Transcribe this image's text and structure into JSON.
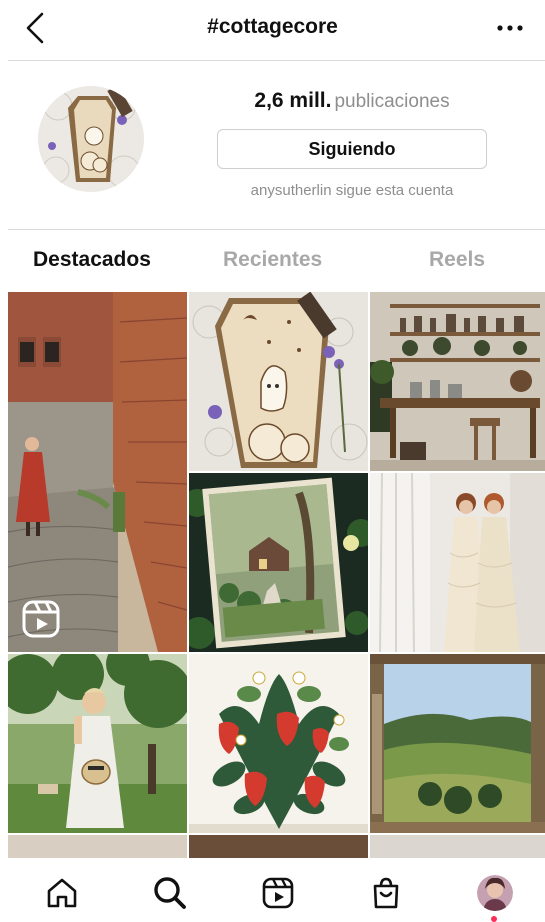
{
  "header": {
    "title": "#cottagecore"
  },
  "profile": {
    "post_count": "2,6 mill.",
    "post_unit": "publicaciones",
    "follow_button": "Siguiendo",
    "follower_note": "anysutherlin sigue esta cuenta"
  },
  "tabs": [
    {
      "label": "Destacados",
      "active": true
    },
    {
      "label": "Recientes",
      "active": false
    },
    {
      "label": "Reels",
      "active": false
    }
  ],
  "nav": [
    "home-icon",
    "search-icon",
    "reels-icon",
    "shop-icon",
    "profile-avatar"
  ],
  "colors": {
    "accent_dot": "#ff2d55",
    "muted_text": "#8e8e8e",
    "divider": "#dbdbdb"
  }
}
